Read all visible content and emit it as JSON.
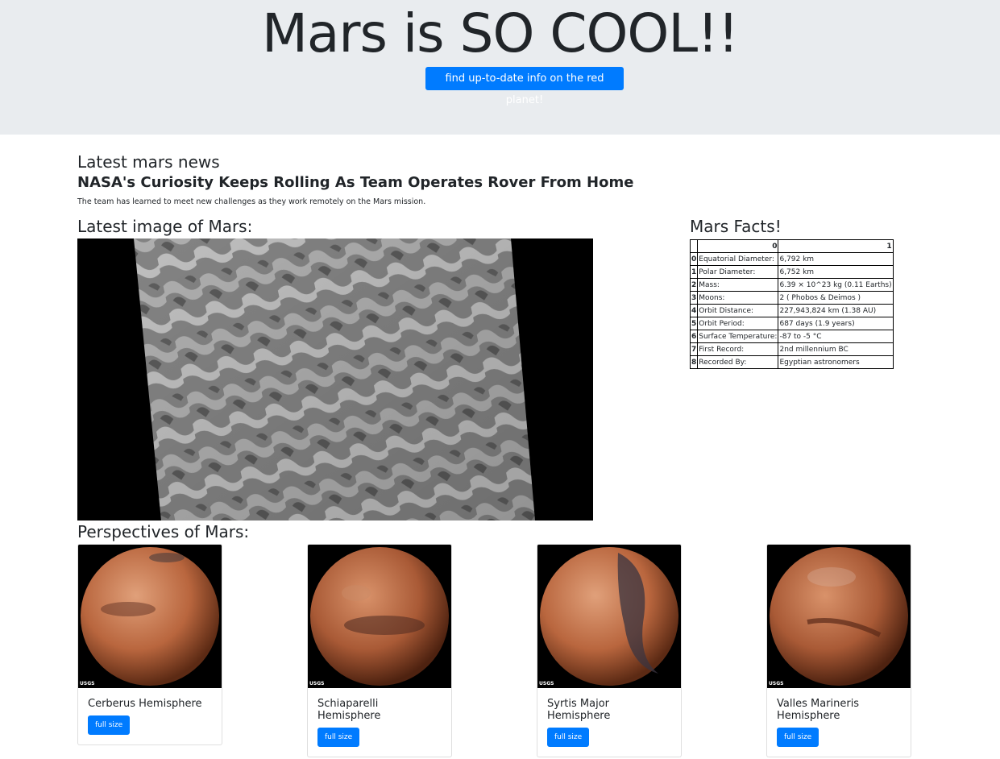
{
  "jumbotron": {
    "title": "Mars is SO COOL!!",
    "scrape_button": "find up-to-date info on the red planet!"
  },
  "news": {
    "heading": "Latest mars news",
    "title": "NASA's Curiosity Keeps Rolling As Team Operates Rover From Home",
    "paragraph": "The team has learned to meet new challenges as they work remotely on the Mars mission."
  },
  "featured": {
    "heading": "Latest image of Mars:"
  },
  "facts": {
    "heading": "Mars Facts!",
    "columns": [
      "0",
      "1"
    ],
    "rows": [
      {
        "idx": "0",
        "label": "Equatorial Diameter:",
        "value": "6,792 km"
      },
      {
        "idx": "1",
        "label": "Polar Diameter:",
        "value": "6,752 km"
      },
      {
        "idx": "2",
        "label": "Mass:",
        "value": "6.39 × 10^23 kg (0.11 Earths)"
      },
      {
        "idx": "3",
        "label": "Moons:",
        "value": "2 ( Phobos & Deimos )"
      },
      {
        "idx": "4",
        "label": "Orbit Distance:",
        "value": "227,943,824 km (1.38 AU)"
      },
      {
        "idx": "5",
        "label": "Orbit Period:",
        "value": "687 days (1.9 years)"
      },
      {
        "idx": "6",
        "label": "Surface Temperature:",
        "value": "-87 to -5 °C"
      },
      {
        "idx": "7",
        "label": "First Record:",
        "value": "2nd millennium BC"
      },
      {
        "idx": "8",
        "label": "Recorded By:",
        "value": "Egyptian astronomers"
      }
    ]
  },
  "hemispheres": {
    "heading": "Perspectives of Mars:",
    "logo_text": "USGS",
    "items": [
      {
        "title": "Cerberus Hemisphere",
        "button": "full size"
      },
      {
        "title": "Schiaparelli Hemisphere",
        "button": "full size"
      },
      {
        "title": "Syrtis Major Hemisphere",
        "button": "full size"
      },
      {
        "title": "Valles Marineris Hemisphere",
        "button": "full size"
      }
    ]
  },
  "colors": {
    "primary": "#007bff",
    "jumbotron_bg": "#e9ecef",
    "text": "#212529"
  }
}
